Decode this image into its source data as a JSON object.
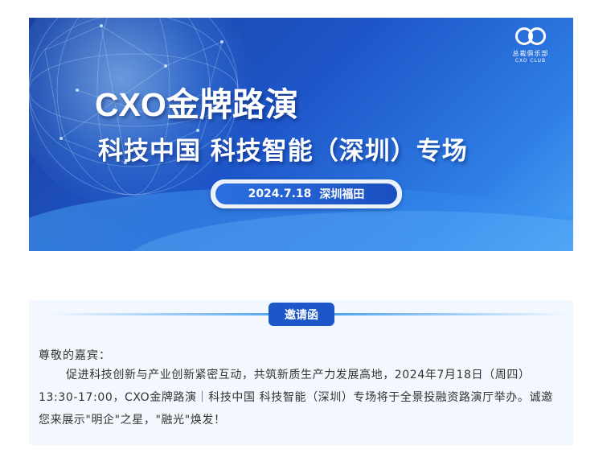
{
  "banner": {
    "logo_name": "总裁俱乐部",
    "logo_sub": "CXO CLUB",
    "title_main": "CXO金牌路演",
    "title_sub": "科技中国 科技智能（深圳）专场",
    "date": "2024.7.18",
    "location": "深圳福田"
  },
  "invitation": {
    "tag_label": "邀请函",
    "greeting": "尊敬的嘉宾：",
    "body": "促进科技创新与产业创新紧密互动，共筑新质生产力发展高地，2024年7月18日（周四）13:30-17:00，CXO金牌路演｜科技中国 科技智能（深圳）专场将于全景投融资路演厅举办。诚邀您来展示\"明企\"之星，\"融光\"焕发！"
  },
  "colors": {
    "banner_blue": "#1e56c9",
    "tag_blue": "#1b57c9",
    "panel_bg": "#f3f8fe"
  }
}
